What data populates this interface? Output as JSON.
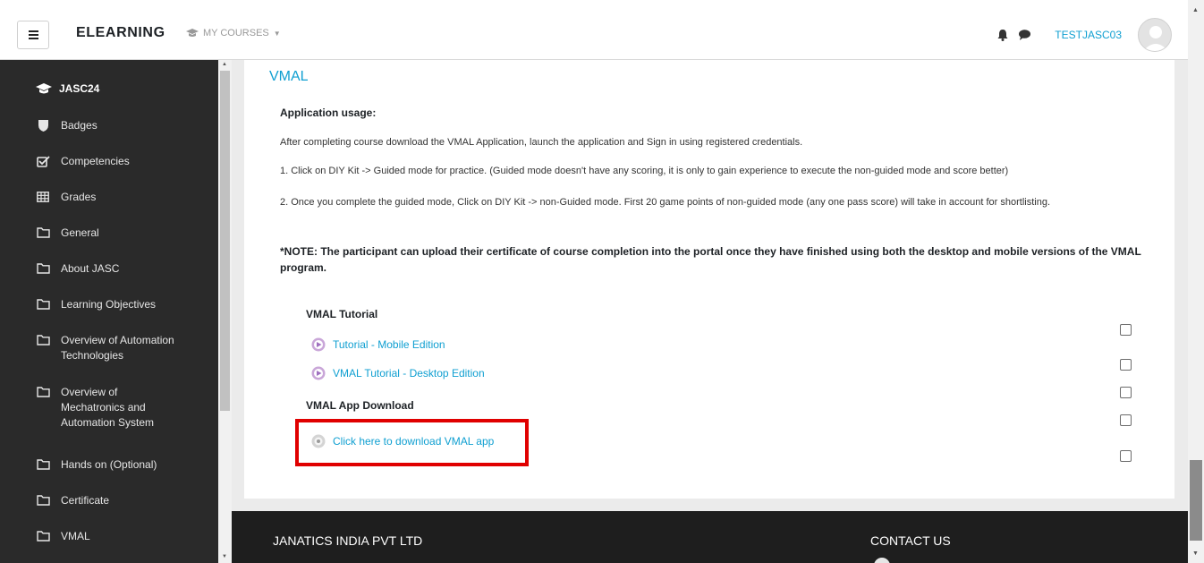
{
  "navbar": {
    "brand": "ELEARNING",
    "my_courses": "MY COURSES",
    "username": "TESTJASC03"
  },
  "sidebar": {
    "course": "JASC24",
    "items": [
      {
        "label": "Badges",
        "icon": "shield-icon"
      },
      {
        "label": "Competencies",
        "icon": "checkbox-icon"
      },
      {
        "label": "Grades",
        "icon": "table-icon"
      },
      {
        "label": "General",
        "icon": "folder-icon"
      },
      {
        "label": "About JASC",
        "icon": "folder-icon"
      },
      {
        "label": "Learning Objectives",
        "icon": "folder-icon"
      },
      {
        "label": "Overview of Automation Technologies",
        "icon": "folder-icon"
      },
      {
        "label": "Overview of Mechatronics and Automation System",
        "icon": "folder-icon"
      },
      {
        "label": "Hands on (Optional)",
        "icon": "folder-icon"
      },
      {
        "label": "Certificate",
        "icon": "folder-icon"
      },
      {
        "label": "VMAL",
        "icon": "folder-icon"
      }
    ]
  },
  "main": {
    "section_title": "VMAL",
    "app_usage_heading": "Application usage:",
    "para1": "After completing course download the VMAL Application, launch the application and Sign in using registered credentials.",
    "para2": "1. Click on DIY Kit -> Guided mode for practice. (Guided mode doesn't have any scoring, it is only to gain experience to execute the non-guided mode and score better)",
    "para3": "2. Once you complete the guided mode, Click on DIY Kit -> non-Guided mode. First 20 game points of non-guided mode (any one pass score) will take in account for shortlisting.",
    "note": "*NOTE: The participant can upload their certificate of course completion into the portal once they have finished using both the desktop and mobile versions of the VMAL program.",
    "tutorial_heading": "VMAL Tutorial",
    "tutorial_mobile": "Tutorial - Mobile Edition",
    "tutorial_desktop": "VMAL Tutorial - Desktop Edition",
    "download_heading": "VMAL App Download",
    "download_link": "Click here to download VMAL app"
  },
  "footer": {
    "company": "JANATICS INDIA PVT LTD",
    "contact": "CONTACT US"
  },
  "colors": {
    "accent": "#0f9fd1",
    "sidebar_bg": "#2a2a2a",
    "footer_bg": "#1e1e1e",
    "highlight": "#e00000"
  }
}
